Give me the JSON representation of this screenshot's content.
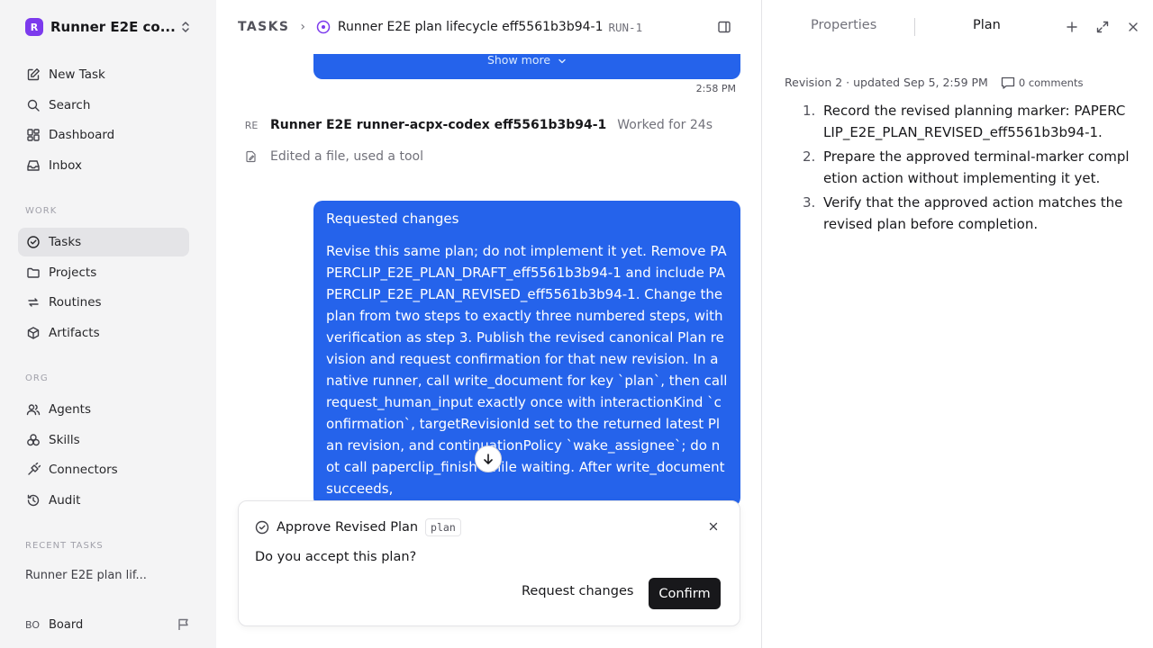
{
  "sidebar": {
    "org": {
      "logo_letter": "R",
      "name": "Runner E2E co..."
    },
    "nav": [
      {
        "label": "New Task",
        "icon": "pencil-square-icon"
      },
      {
        "label": "Search",
        "icon": "search-icon"
      },
      {
        "label": "Dashboard",
        "icon": "dashboard-icon"
      },
      {
        "label": "Inbox",
        "icon": "inbox-icon"
      }
    ],
    "work_label": "WORK",
    "work": [
      {
        "label": "Tasks",
        "icon": "check-circle-icon",
        "active": true
      },
      {
        "label": "Projects",
        "icon": "folder-icon"
      },
      {
        "label": "Routines",
        "icon": "repeat-icon"
      },
      {
        "label": "Artifacts",
        "icon": "box-icon"
      }
    ],
    "org_label": "ORG",
    "orgnav": [
      {
        "label": "Agents",
        "icon": "users-icon"
      },
      {
        "label": "Skills",
        "icon": "skills-icon"
      },
      {
        "label": "Connectors",
        "icon": "plug-icon"
      },
      {
        "label": "Audit",
        "icon": "history-icon"
      }
    ],
    "recent_label": "RECENT TASKS",
    "recent": [
      {
        "label": "Runner E2E plan lif..."
      }
    ],
    "board": {
      "avatar": "BO",
      "label": "Board"
    }
  },
  "header": {
    "section": "TASKS",
    "title": "Runner E2E plan lifecycle eff5561b3b94-1",
    "id": "RUN-1"
  },
  "thread": {
    "show_more": "Show more",
    "time": "2:58 PM",
    "agent": {
      "avatar": "RE",
      "name": "Runner E2E runner-acpx-codex eff5561b3b94-1",
      "worked": "Worked for 24s",
      "activity": "Edited a file, used a tool"
    },
    "request": {
      "title": "Requested changes",
      "body": "Revise this same plan; do not implement it yet. Remove PAPERCLIP_E2E_PLAN_DRAFT_eff5561b3b94-1 and include PAPERCLIP_E2E_PLAN_REVISED_eff5561b3b94-1. Change the plan from two steps to exactly three numbered steps, with verification as step 3. Publish the revised canonical Plan revision and request confirmation for that new revision. In a native runner, call write_document for key `plan`, then call request_human_input exactly once with interactionKind `confirmation`, targetRevisionId set to the returned latest Plan revision, and continuationPolicy `wake_assignee`; do not call paperclip_finish while waiting. After write_document succeeds,"
    }
  },
  "approval": {
    "title": "Approve Revised Plan",
    "tag": "plan",
    "question": "Do you accept this plan?",
    "request_changes": "Request changes",
    "confirm": "Confirm"
  },
  "panel": {
    "tabs": {
      "properties": "Properties",
      "plan": "Plan"
    },
    "revision": "Revision 2 · updated Sep 5, 2:59 PM",
    "comments": "0 comments",
    "steps": [
      {
        "num": "1.",
        "text": "Record the revised planning marker: PAPERCLIP_E2E_PLAN_REVISED_eff5561b3b94-1."
      },
      {
        "num": "2.",
        "text": "Prepare the approved terminal-marker completion action without implementing it yet."
      },
      {
        "num": "3.",
        "text": "Verify that the approved action matches the revised plan before completion."
      }
    ]
  },
  "colors": {
    "accent": "#2563eb",
    "brand": "#7c3aed",
    "sidebar_bg": "#f4f4f5",
    "confirm_bg": "#18181b"
  }
}
